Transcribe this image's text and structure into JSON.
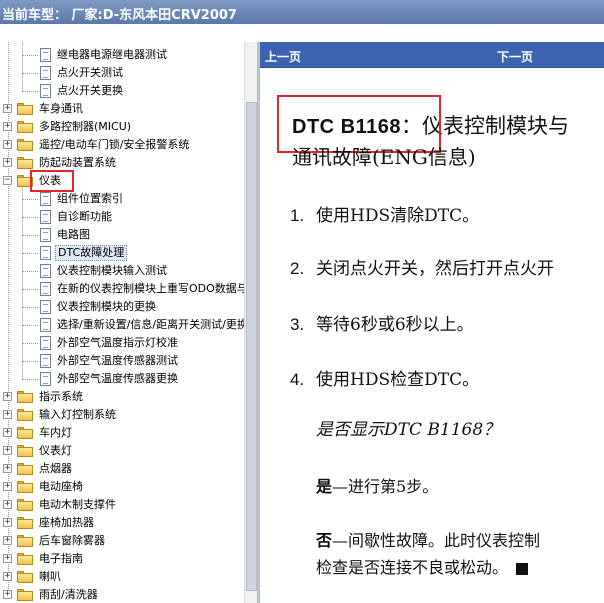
{
  "window": {
    "title_label": "当前车型：",
    "title_value": "厂家:D-东风本田CRV2007"
  },
  "tree": {
    "items": [
      {
        "label": "继电器电源继电器测试",
        "level": 1,
        "type": "doc"
      },
      {
        "label": "点火开关测试",
        "level": 1,
        "type": "doc"
      },
      {
        "label": "点火开关更换",
        "level": 1,
        "type": "doc"
      },
      {
        "label": "车身通讯",
        "level": 0,
        "type": "folder",
        "expanded": false
      },
      {
        "label": "多路控制器(MICU)",
        "level": 0,
        "type": "folder",
        "expanded": false
      },
      {
        "label": "遥控/电动车门锁/安全报警系统",
        "level": 0,
        "type": "folder",
        "expanded": false
      },
      {
        "label": "防起动装置系统",
        "level": 0,
        "type": "folder",
        "expanded": false
      },
      {
        "label": "仪表",
        "level": 0,
        "type": "folder",
        "expanded": true
      },
      {
        "label": "组件位置索引",
        "level": 1,
        "type": "doc"
      },
      {
        "label": "自诊断功能",
        "level": 1,
        "type": "doc"
      },
      {
        "label": "电路图",
        "level": 1,
        "type": "doc"
      },
      {
        "label": "DTC故障处理",
        "level": 1,
        "type": "doc",
        "selected": true
      },
      {
        "label": "仪表控制模块输入测试",
        "level": 1,
        "type": "doc"
      },
      {
        "label": "在新的仪表控制模块上重写ODO数据与",
        "level": 1,
        "type": "doc"
      },
      {
        "label": "仪表控制模块的更换",
        "level": 1,
        "type": "doc"
      },
      {
        "label": "选择/重新设置/信息/距离开关测试/更换",
        "level": 1,
        "type": "doc"
      },
      {
        "label": "外部空气温度指示灯校准",
        "level": 1,
        "type": "doc"
      },
      {
        "label": "外部空气温度传感器测试",
        "level": 1,
        "type": "doc"
      },
      {
        "label": "外部空气温度传感器更换",
        "level": 1,
        "type": "doc"
      },
      {
        "label": "指示系统",
        "level": 0,
        "type": "folder",
        "expanded": false
      },
      {
        "label": "输入灯控制系统",
        "level": 0,
        "type": "folder",
        "expanded": false
      },
      {
        "label": "车内灯",
        "level": 0,
        "type": "folder",
        "expanded": false
      },
      {
        "label": "仪表灯",
        "level": 0,
        "type": "folder",
        "expanded": false
      },
      {
        "label": "点烟器",
        "level": 0,
        "type": "folder",
        "expanded": false
      },
      {
        "label": "电动座椅",
        "level": 0,
        "type": "folder",
        "expanded": false
      },
      {
        "label": "电动木制支撑件",
        "level": 0,
        "type": "folder",
        "expanded": false
      },
      {
        "label": "座椅加热器",
        "level": 0,
        "type": "folder",
        "expanded": false
      },
      {
        "label": "后车窗除雾器",
        "level": 0,
        "type": "folder",
        "expanded": false
      },
      {
        "label": "电子指南",
        "level": 0,
        "type": "folder",
        "expanded": false
      },
      {
        "label": "喇叭",
        "level": 0,
        "type": "folder",
        "expanded": false
      },
      {
        "label": "雨刮/清洗器",
        "level": 0,
        "type": "folder",
        "expanded": false
      }
    ]
  },
  "viewer": {
    "prev_label": "上一页",
    "next_label": "下一页",
    "title_code": "DTC B1168",
    "title_rest": "：仪表控制模块与",
    "title_line2": "通讯故障(ENG信息)",
    "steps": [
      {
        "num": "1.",
        "text": "使用HDS清除DTC。"
      },
      {
        "num": "2.",
        "text": "关闭点火开关，然后打开点火开"
      },
      {
        "num": "3.",
        "text": "等待6秒或6秒以上。"
      },
      {
        "num": "4.",
        "text": "使用HDS检查DTC。"
      }
    ],
    "question": "是否显示DTC B1168？",
    "yes_label": "是",
    "yes_text": "—进行第5步。",
    "no_label": "否",
    "no_text": "—间歇性故障。此时仪表控制",
    "no_text2": "检查是否连接不良或松动。"
  },
  "colors": {
    "titlebar": "#6b87b8",
    "navbar": "#3a63b2",
    "highlight_box": "#e8232b",
    "selection": "#dde9f5"
  }
}
